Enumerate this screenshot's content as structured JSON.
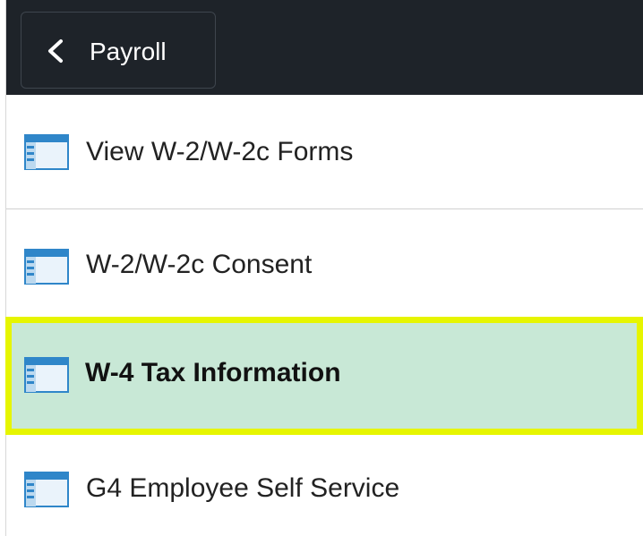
{
  "header": {
    "back_label": "Payroll",
    "icon": "chevron-left-icon",
    "background": "#1e2329"
  },
  "menu": {
    "items": [
      {
        "label": "View W-2/W-2c Forms",
        "icon": "page-layout-icon",
        "selected": false
      },
      {
        "label": "W-2/W-2c Consent",
        "icon": "page-layout-icon",
        "selected": false
      },
      {
        "label": "W-4 Tax Information",
        "icon": "page-layout-icon",
        "selected": true
      },
      {
        "label": "G4 Employee Self Service",
        "icon": "page-layout-icon",
        "selected": false
      }
    ],
    "selected_background": "#c8e8d6",
    "highlight_border": "#e6f500"
  }
}
